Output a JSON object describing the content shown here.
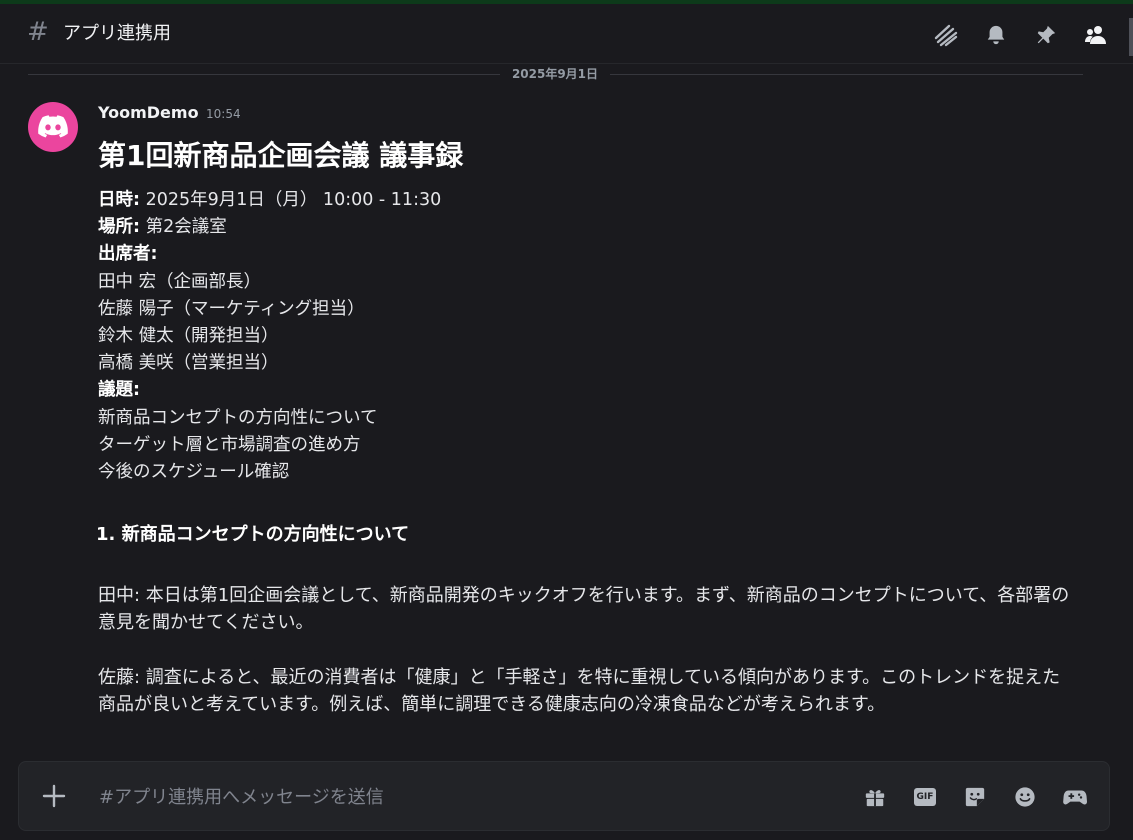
{
  "header": {
    "hash_symbol": "#",
    "channel_name": "アプリ連携用",
    "icons": [
      "threads-icon",
      "bell-icon",
      "pin-icon",
      "members-icon"
    ]
  },
  "divider": {
    "date": "2025年9月1日"
  },
  "message": {
    "author": "YoomDemo",
    "time": "10:54",
    "avatar_color": "#eb459e",
    "title": "第1回新商品企画会議 議事録",
    "datetime_label": "日時:",
    "datetime_value": " 2025年9月1日（月） 10:00 - 11:30",
    "place_label": "場所:",
    "place_value": " 第2会議室",
    "attendees_label": "出席者:",
    "attendees": [
      "田中 宏（企画部長）",
      "佐藤 陽子（マーケティング担当）",
      "鈴木 健太（開発担当）",
      "高橋 美咲（営業担当）"
    ],
    "agenda_label": "議題:",
    "agenda": [
      "新商品コンセプトの方向性について",
      "ターゲット層と市場調査の進め方",
      "今後のスケジュール確認"
    ],
    "section_heading": "1. 新商品コンセプトの方向性について",
    "paragraphs": [
      "田中: 本日は第1回企画会議として、新商品開発のキックオフを行います。まず、新商品のコンセプトについて、各部署の意見を聞かせてください。",
      "佐藤: 調査によると、最近の消費者は「健康」と「手軽さ」を特に重視している傾向があります。このトレンドを捉えた商品が良いと考えています。例えば、簡単に調理できる健康志向の冷凍食品などが考えられます。"
    ]
  },
  "composer": {
    "placeholder": "#アプリ連携用へメッセージを送信",
    "value": "",
    "gif_label": "GIF",
    "icons": [
      "plus-icon",
      "gift-icon",
      "gif-icon",
      "sticker-icon",
      "emoji-icon",
      "gamepad-icon"
    ]
  },
  "colors": {
    "background": "#1a1a1e",
    "composer_bg": "#222327",
    "accent_pink": "#eb459e",
    "text": "#dbdee1",
    "muted": "#949ba4"
  }
}
